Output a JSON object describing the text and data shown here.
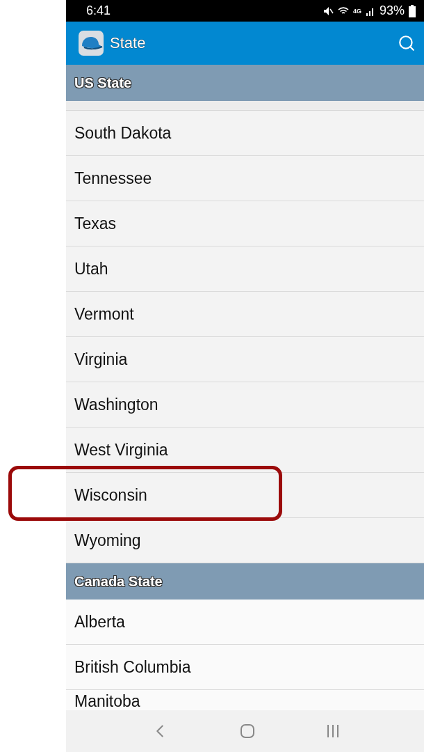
{
  "status_bar": {
    "time": "6:41",
    "network": "4G",
    "battery": "93%"
  },
  "app_bar": {
    "title": "State"
  },
  "sections": [
    {
      "title": "US State",
      "partial_top": true,
      "items": [
        {
          "label": "South Dakota",
          "highlighted": false
        },
        {
          "label": "Tennessee",
          "highlighted": false
        },
        {
          "label": "Texas",
          "highlighted": false
        },
        {
          "label": "Utah",
          "highlighted": false
        },
        {
          "label": "Vermont",
          "highlighted": false
        },
        {
          "label": "Virginia",
          "highlighted": false
        },
        {
          "label": "Washington",
          "highlighted": false
        },
        {
          "label": "West Virginia",
          "highlighted": false
        },
        {
          "label": "Wisconsin",
          "highlighted": true
        },
        {
          "label": "Wyoming",
          "highlighted": false
        }
      ]
    },
    {
      "title": "Canada State",
      "partial_top": false,
      "items": [
        {
          "label": "Alberta",
          "highlighted": false
        },
        {
          "label": "British Columbia",
          "highlighted": false
        },
        {
          "label": "Manitoba",
          "highlighted": false
        }
      ]
    }
  ]
}
